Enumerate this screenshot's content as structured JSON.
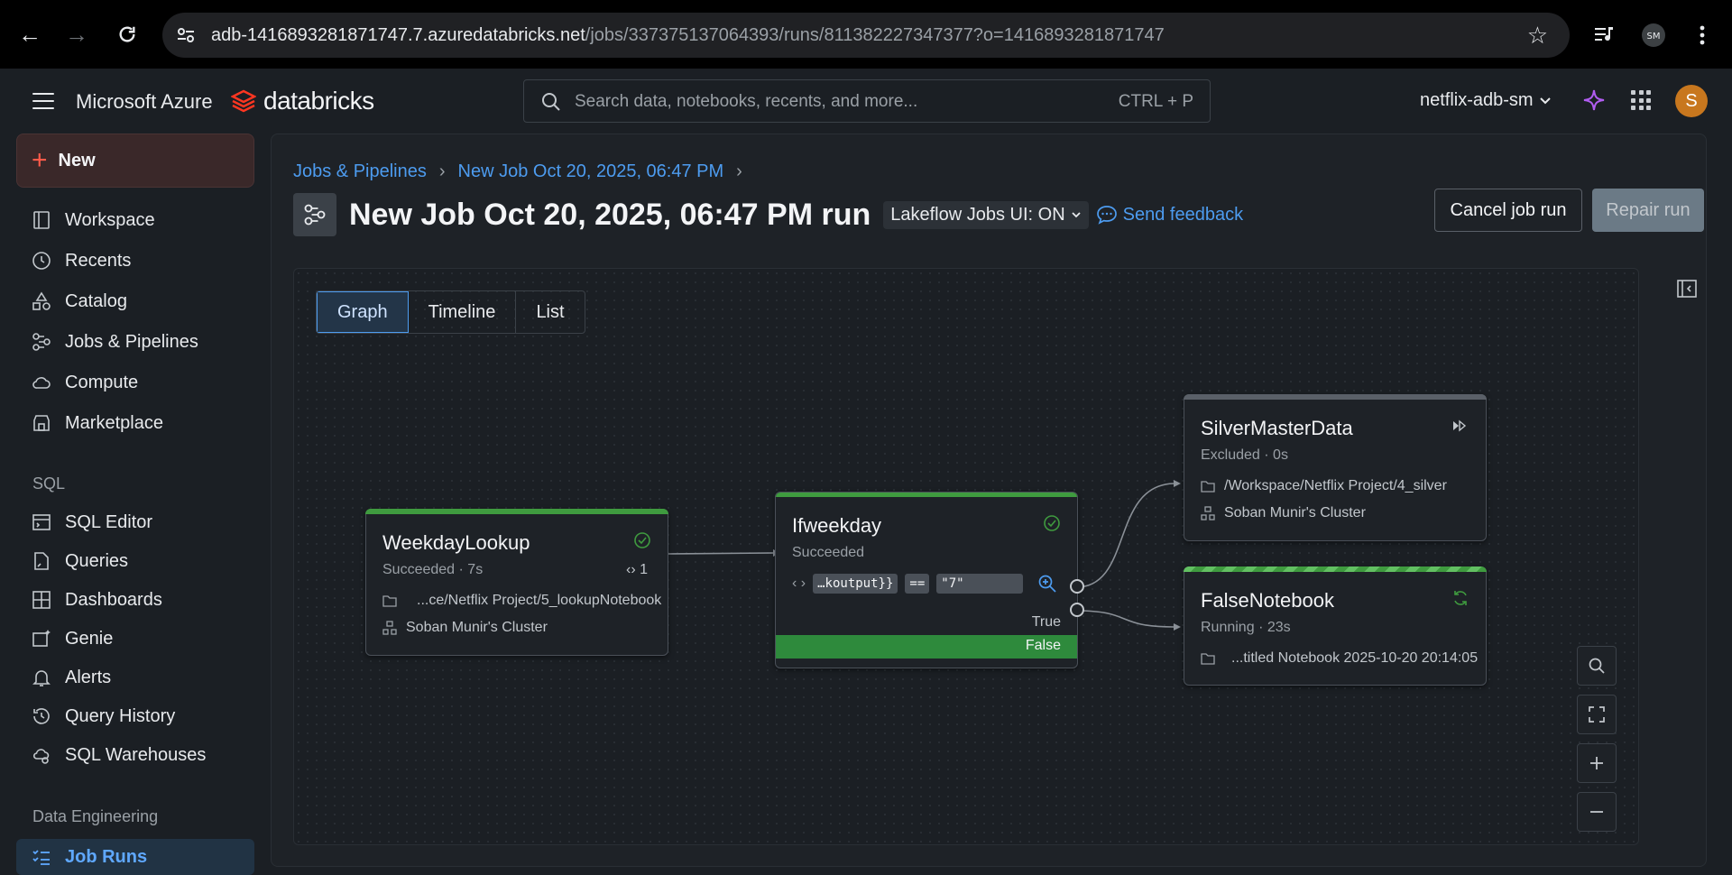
{
  "browser": {
    "url_host": "adb-1416893281871747.7.azuredatabricks.net",
    "url_path": "/jobs/337375137064393/runs/811382227347377?o=1416893281871747"
  },
  "topbar": {
    "brand_ms": "Microsoft Azure",
    "brand_db": "databricks",
    "search_placeholder": "Search data, notebooks, recents, and more...",
    "search_shortcut": "CTRL + P",
    "workspace": "netflix-adb-sm",
    "avatar_initial": "S"
  },
  "sidebar": {
    "new_label": "New",
    "items": [
      {
        "label": "Workspace"
      },
      {
        "label": "Recents"
      },
      {
        "label": "Catalog"
      },
      {
        "label": "Jobs & Pipelines"
      },
      {
        "label": "Compute"
      },
      {
        "label": "Marketplace"
      }
    ],
    "sql_section": "SQL",
    "sql_items": [
      {
        "label": "SQL Editor"
      },
      {
        "label": "Queries"
      },
      {
        "label": "Dashboards"
      },
      {
        "label": "Genie"
      },
      {
        "label": "Alerts"
      },
      {
        "label": "Query History"
      },
      {
        "label": "SQL Warehouses"
      }
    ],
    "de_section": "Data Engineering",
    "de_items": [
      {
        "label": "Job Runs"
      }
    ]
  },
  "main": {
    "breadcrumb": [
      "Jobs & Pipelines",
      "New Job Oct 20, 2025, 06:47 PM"
    ],
    "title": "New Job Oct 20, 2025, 06:47 PM run",
    "ui_toggle": "Lakeflow Jobs UI: ON",
    "feedback": "Send feedback",
    "cancel_label": "Cancel job run",
    "repair_label": "Repair run",
    "tabs": [
      "Graph",
      "Timeline",
      "List"
    ],
    "active_tab": "Graph"
  },
  "graph": {
    "colors": {
      "success": "#3f9b3f",
      "excluded": "#5a6068",
      "running": "#3f9b3f"
    },
    "nodes": {
      "weekday": {
        "name": "WeekdayLookup",
        "status": "Succeeded",
        "duration": "· 7s",
        "outputs": "1",
        "path": "...ce/Netflix Project/5_lookupNotebook",
        "cluster": "Soban Munir's Cluster"
      },
      "ifweekday": {
        "name": "Ifweekday",
        "status": "Succeeded",
        "left_operand": "…koutput}}",
        "operator": "==",
        "right_operand": "\"7\"",
        "true_label": "True",
        "false_label": "False"
      },
      "silver": {
        "name": "SilverMasterData",
        "status": "Excluded",
        "duration": "· 0s",
        "path": "/Workspace/Netflix Project/4_silver",
        "cluster": "Soban Munir's Cluster"
      },
      "falsenb": {
        "name": "FalseNotebook",
        "status": "Running",
        "duration": "· 23s",
        "path": "...titled Notebook 2025-10-20 20:14:05"
      }
    }
  }
}
